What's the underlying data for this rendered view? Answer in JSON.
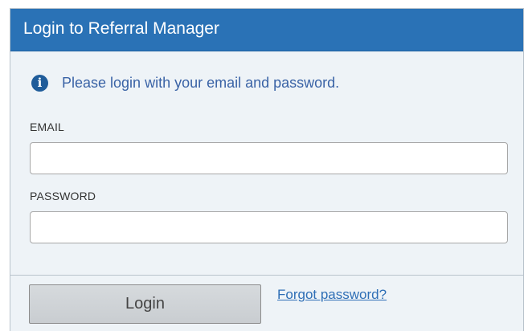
{
  "dialog": {
    "title": "Login to Referral Manager",
    "info_icon": "info-icon",
    "info_message": "Please login with your email and password."
  },
  "form": {
    "email": {
      "label": "EMAIL",
      "value": "",
      "placeholder": ""
    },
    "password": {
      "label": "PASSWORD",
      "value": "",
      "placeholder": ""
    }
  },
  "actions": {
    "login_label": "Login",
    "forgot_password_label": "Forgot password?"
  },
  "colors": {
    "header_background": "#2a72b6",
    "panel_background": "#eef3f7",
    "info_text": "#3a63a6",
    "link": "#2f6fb6"
  }
}
